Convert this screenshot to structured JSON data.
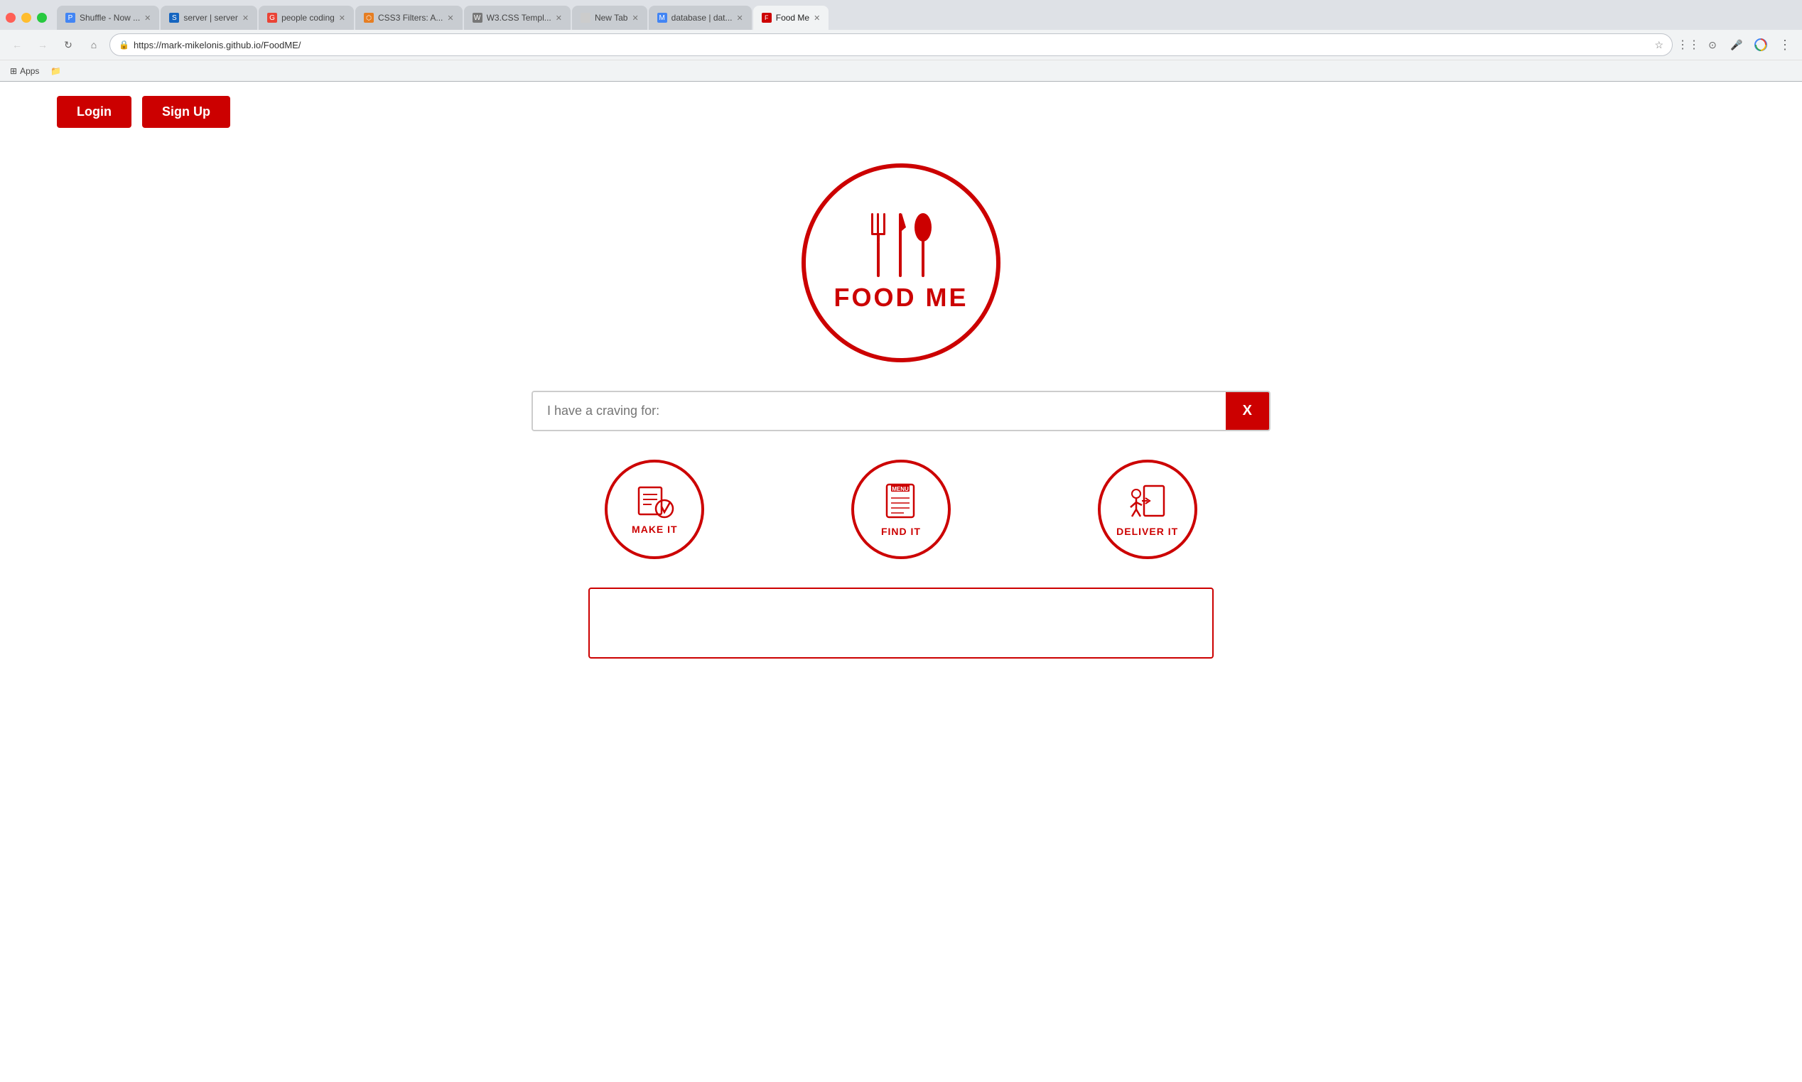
{
  "browser": {
    "tabs": [
      {
        "id": "tab-shuffle",
        "label": "Shuffle - Now ...",
        "favicon_color": "#4285f4",
        "favicon_text": "P",
        "active": false
      },
      {
        "id": "tab-server",
        "label": "server | server",
        "favicon_color": "#1565c0",
        "favicon_text": "S",
        "active": false
      },
      {
        "id": "tab-people",
        "label": "people coding",
        "favicon_color": "#ea4335",
        "favicon_text": "G",
        "active": false
      },
      {
        "id": "tab-css3",
        "label": "CSS3 Filters: A...",
        "favicon_color": "#e67e22",
        "favicon_text": "⬡",
        "active": false
      },
      {
        "id": "tab-w3css",
        "label": "W3.CSS Templ...",
        "favicon_color": "#777",
        "favicon_text": "W",
        "active": false
      },
      {
        "id": "tab-newtab",
        "label": "New Tab",
        "favicon_color": "#777",
        "favicon_text": "",
        "active": false
      },
      {
        "id": "tab-database",
        "label": "database | dat...",
        "favicon_color": "#4285f4",
        "favicon_text": "M",
        "active": false
      },
      {
        "id": "tab-foodme",
        "label": "Food Me",
        "favicon_color": "#cc0000",
        "favicon_text": "F",
        "active": true
      }
    ],
    "url": "https://mark-mikelonis.github.io/FoodME/",
    "url_protocol": "Secure",
    "lock_icon": "🔒"
  },
  "bookmarks": {
    "apps_label": "Apps"
  },
  "page": {
    "login_label": "Login",
    "signup_label": "Sign Up",
    "logo_text": "FOOD ME",
    "search_placeholder": "I have a craving for:",
    "search_clear_label": "X",
    "actions": [
      {
        "id": "make-it",
        "label": "MAKE IT",
        "icon_type": "recipe"
      },
      {
        "id": "find-it",
        "label": "FIND IT",
        "icon_type": "menu"
      },
      {
        "id": "deliver-it",
        "label": "DELIVER IT",
        "icon_type": "delivery"
      }
    ],
    "accent_color": "#cc0000"
  }
}
